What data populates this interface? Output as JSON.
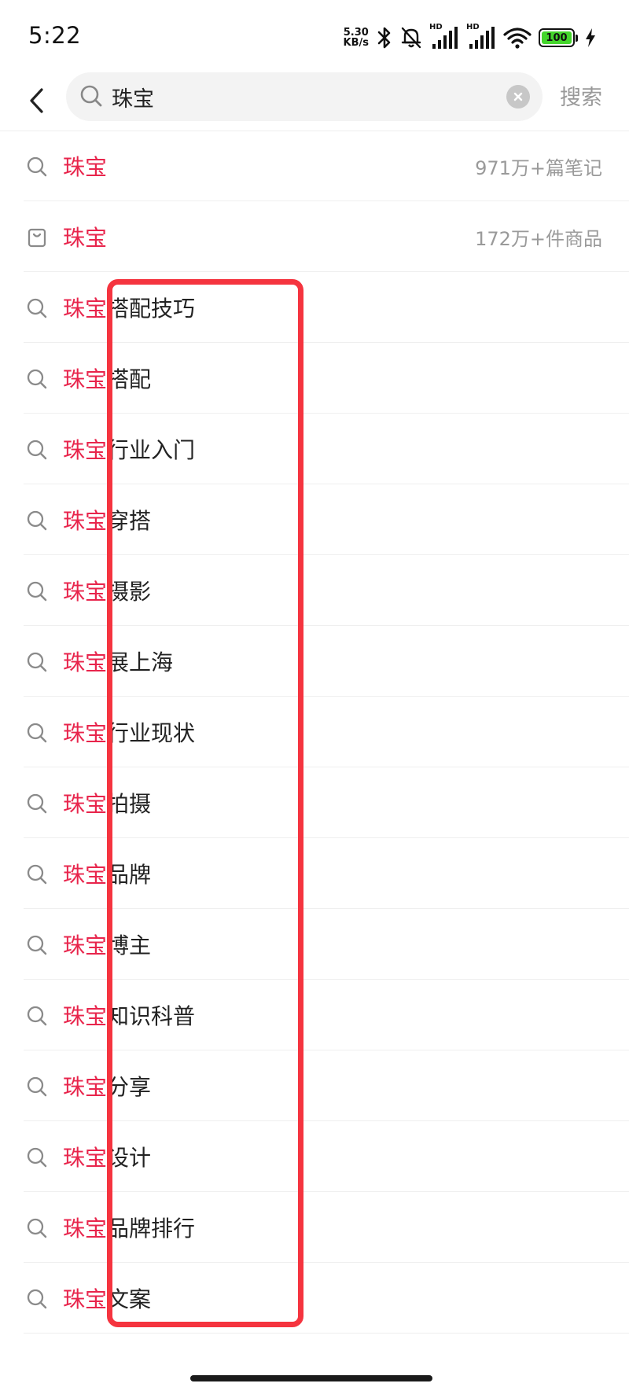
{
  "status_bar": {
    "time": "5:22",
    "net_speed_value": "5.30",
    "net_speed_unit": "KB/s",
    "signal_tag": "HD",
    "battery_level": "100",
    "icons": [
      "bluetooth-icon",
      "bell-off-icon",
      "signal-icon",
      "signal-icon",
      "wifi-icon",
      "battery-icon",
      "charging-icon"
    ]
  },
  "search": {
    "query": "珠宝",
    "button_label": "搜索"
  },
  "suggestions": [
    {
      "icon": "search-icon",
      "highlight": "珠宝",
      "rest": "",
      "meta": "971万+篇笔记"
    },
    {
      "icon": "shopping-bag-icon",
      "highlight": "珠宝",
      "rest": "",
      "meta": "172万+件商品"
    },
    {
      "icon": "search-icon",
      "highlight": "珠宝",
      "rest": "搭配技巧",
      "meta": ""
    },
    {
      "icon": "search-icon",
      "highlight": "珠宝",
      "rest": "搭配",
      "meta": ""
    },
    {
      "icon": "search-icon",
      "highlight": "珠宝",
      "rest": "行业入门",
      "meta": ""
    },
    {
      "icon": "search-icon",
      "highlight": "珠宝",
      "rest": "穿搭",
      "meta": ""
    },
    {
      "icon": "search-icon",
      "highlight": "珠宝",
      "rest": "摄影",
      "meta": ""
    },
    {
      "icon": "search-icon",
      "highlight": "珠宝",
      "rest": "展上海",
      "meta": ""
    },
    {
      "icon": "search-icon",
      "highlight": "珠宝",
      "rest": "行业现状",
      "meta": ""
    },
    {
      "icon": "search-icon",
      "highlight": "珠宝",
      "rest": "拍摄",
      "meta": ""
    },
    {
      "icon": "search-icon",
      "highlight": "珠宝",
      "rest": "品牌",
      "meta": ""
    },
    {
      "icon": "search-icon",
      "highlight": "珠宝",
      "rest": "博主",
      "meta": ""
    },
    {
      "icon": "search-icon",
      "highlight": "珠宝",
      "rest": "知识科普",
      "meta": ""
    },
    {
      "icon": "search-icon",
      "highlight": "珠宝",
      "rest": "分享",
      "meta": ""
    },
    {
      "icon": "search-icon",
      "highlight": "珠宝",
      "rest": "设计",
      "meta": ""
    },
    {
      "icon": "search-icon",
      "highlight": "珠宝",
      "rest": "品牌排行",
      "meta": ""
    },
    {
      "icon": "search-icon",
      "highlight": "珠宝",
      "rest": "文案",
      "meta": ""
    }
  ],
  "colors": {
    "highlight": "#e8254c",
    "annotation": "#f5343f",
    "meta_text": "#9a9a9a",
    "search_button": "#999999"
  }
}
